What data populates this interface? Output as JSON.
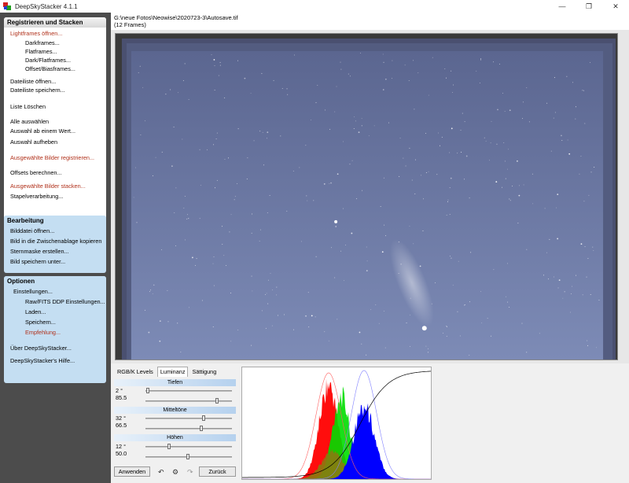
{
  "window": {
    "title": "DeepSkyStacker 4.1.1"
  },
  "window_controls": {
    "minimize": "—",
    "maximize": "❐",
    "close": "✕"
  },
  "sidebar": {
    "group1": {
      "title": "Registrieren und Stacken",
      "items": [
        "Lightframes öffnen...",
        "Darkframes...",
        "Flatframes...",
        "Dark/Flatframes...",
        "Offset/Biasframes...",
        "Dateiliste öffnen...",
        "Dateiliste speichern...",
        "Liste Löschen",
        "Alle auswählen",
        "Auswahl ab einem Wert...",
        "Auswahl aufheben",
        "Ausgewählte Bilder registrieren...",
        "Offsets berechnen...",
        "Ausgewählte Bilder stacken...",
        "Stapelverarbeitung..."
      ]
    },
    "group2": {
      "title": "Bearbeitung",
      "items": [
        "Bilddatei öffnen...",
        "Bild in die Zwischenablage kopieren",
        "Sternmaske erstellen...",
        "Bild speichern unter..."
      ]
    },
    "group3": {
      "title": "Optionen",
      "items": [
        "Einstellungen...",
        "Raw/FITS DDP Einstellungen...",
        "Laden...",
        "Speichern...",
        "Empfehlung...",
        "Über DeepSkyStacker...",
        "DeepSkyStacker's Hilfe..."
      ]
    }
  },
  "header": {
    "path": "G:\\neue Fotos\\Neowise\\2020723-3\\Autosave.tif",
    "frames": "(12 Frames)"
  },
  "tabs": [
    "RGB/K Levels",
    "Luminanz",
    "Sättigung"
  ],
  "active_tab": "Luminanz",
  "sliders": {
    "tiefen": {
      "label": "Tiefen",
      "val1": "2 °",
      "val2": "85.5",
      "pos1": 0.01,
      "pos2": 0.855
    },
    "mitteltoene": {
      "label": "Mitteltöne",
      "val1": "32 °",
      "val2": "66.5",
      "pos1": 0.69,
      "pos2": 0.665
    },
    "hoehen": {
      "label": "Höhen",
      "val1": "12 °",
      "val2": "50.0",
      "pos1": 0.27,
      "pos2": 0.5
    }
  },
  "buttons": {
    "apply": "Anwenden",
    "back": "Zurück"
  },
  "icons": {
    "undo": "undo-icon",
    "settings": "gear-icon",
    "redo": "redo-icon"
  },
  "colors": {
    "sidebar_bg": "#4c4c4c",
    "group_blue": "#c4def2",
    "link_red": "#b0301a",
    "sky": "#6f7ea9",
    "histo_red": "#ff0000",
    "histo_green": "#00dd00",
    "histo_blue": "#0000ff"
  }
}
